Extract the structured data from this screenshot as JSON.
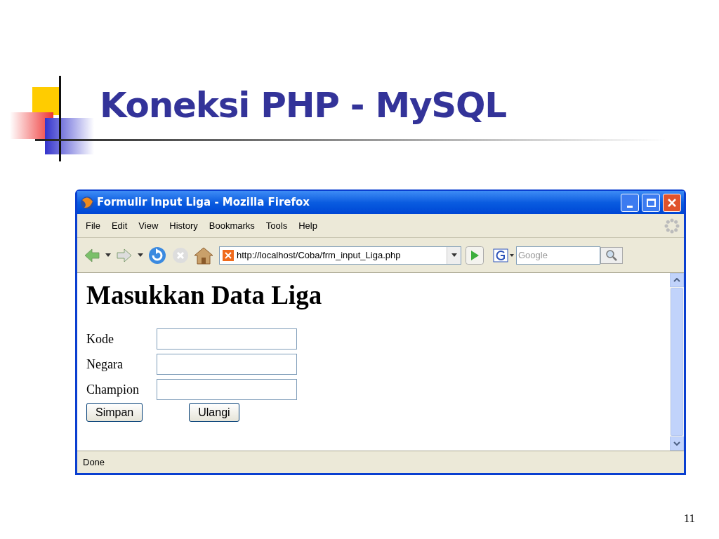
{
  "slide": {
    "title": "Koneksi PHP - MySQL",
    "page_number": "11"
  },
  "browser": {
    "title": "Formulir Input Liga - Mozilla Firefox",
    "menu": [
      "File",
      "Edit",
      "View",
      "History",
      "Bookmarks",
      "Tools",
      "Help"
    ],
    "url": "http://localhost/Coba/frm_input_Liga.php",
    "search": {
      "placeholder": "Google"
    },
    "page": {
      "heading": "Masukkan Data Liga",
      "fields": [
        {
          "label": "Kode"
        },
        {
          "label": "Negara"
        },
        {
          "label": "Champion"
        }
      ],
      "buttons": [
        "Simpan",
        "Ulangi"
      ]
    },
    "status_bar": "Done"
  }
}
